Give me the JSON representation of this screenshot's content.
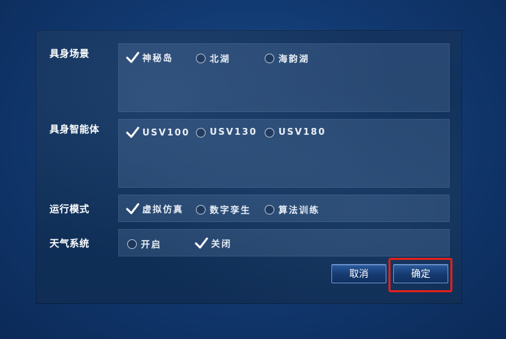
{
  "rows": [
    {
      "label": "具身场景",
      "options": [
        {
          "label": "神秘岛",
          "checked": true
        },
        {
          "label": "北湖",
          "checked": false
        },
        {
          "label": "海韵湖",
          "checked": false
        }
      ]
    },
    {
      "label": "具身智能体",
      "options": [
        {
          "label": "USV100",
          "checked": true
        },
        {
          "label": "USV130",
          "checked": false
        },
        {
          "label": "USV180",
          "checked": false
        }
      ]
    },
    {
      "label": "运行模式",
      "options": [
        {
          "label": "虚拟仿真",
          "checked": true
        },
        {
          "label": "数字孪生",
          "checked": false
        },
        {
          "label": "算法训练",
          "checked": false
        }
      ]
    },
    {
      "label": "天气系统",
      "options": [
        {
          "label": "开启",
          "checked": false
        },
        {
          "label": "关闭",
          "checked": true
        }
      ]
    }
  ],
  "buttons": {
    "cancel": "取消",
    "confirm": "确定"
  },
  "colors": {
    "highlight": "#e0211b",
    "panel": "#14345f",
    "check": "#ffffff"
  }
}
